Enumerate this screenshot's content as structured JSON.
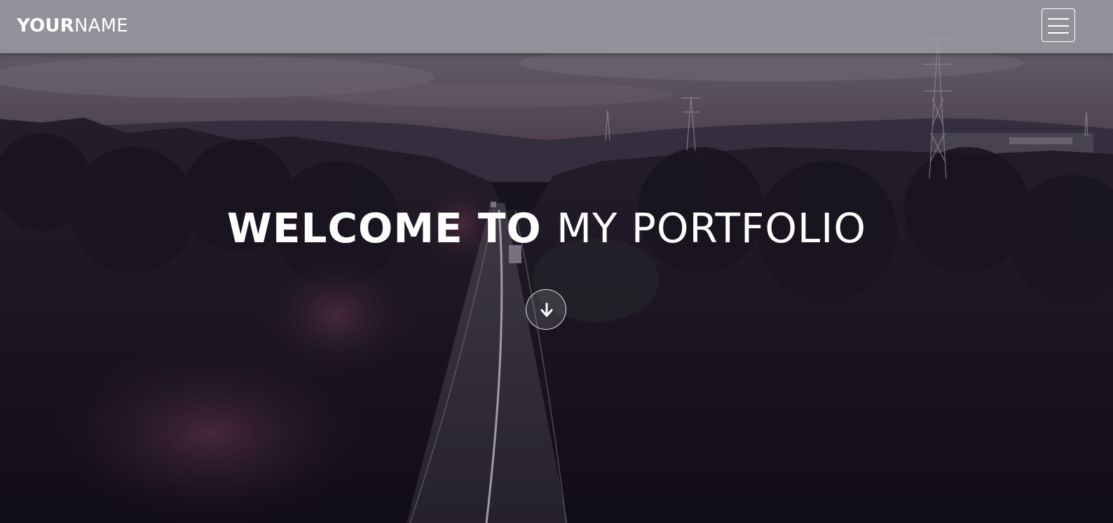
{
  "navbar": {
    "brand_bold": "YOUR",
    "brand_light": "NAME",
    "menu_icon": "hamburger-menu-icon"
  },
  "hero": {
    "title_bold": "WELCOME TO",
    "title_light": "MY PORTFOLIO",
    "scroll_icon": "arrow-down-icon"
  },
  "colors": {
    "navbar_bg": "#a0a0a6",
    "text": "#ffffff",
    "background_dark": "#1a1620"
  }
}
